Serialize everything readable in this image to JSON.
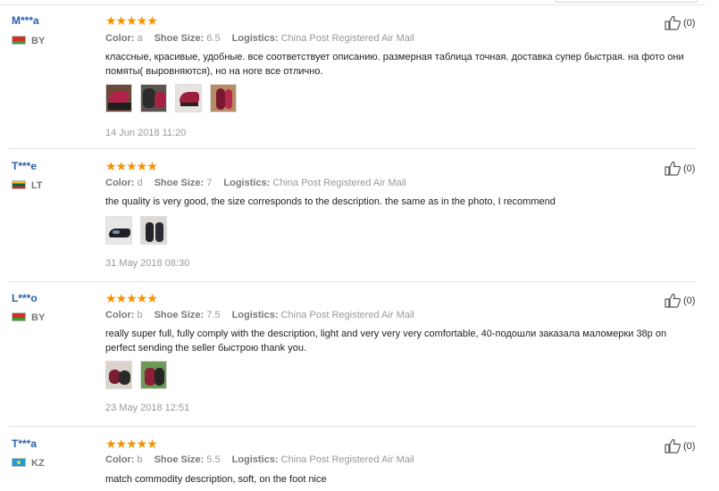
{
  "reviews": [
    {
      "user": "M***a",
      "country": "BY",
      "flag": "by",
      "rating": "★★★★★",
      "color_label": "Color:",
      "color_value": "a",
      "size_label": "Shoe Size:",
      "size_value": "6.5",
      "logistics_label": "Logistics:",
      "logistics_value": "China Post Registered Air Mail",
      "text": "классные, красивые, удобные. все соответствует описанию. размерная таблица точная. доставка супер быстрая. на фото они помяты( выровняются), но на ноге все отлично.",
      "photo_count": 4,
      "date": "14 Jun 2018 11:20",
      "helpful": "(0)"
    },
    {
      "user": "T***e",
      "country": "LT",
      "flag": "lt",
      "rating": "★★★★★",
      "color_label": "Color:",
      "color_value": "d",
      "size_label": "Shoe Size:",
      "size_value": "7",
      "logistics_label": "Logistics:",
      "logistics_value": "China Post Registered Air Mail",
      "text": "the quality is very good, the size corresponds to the description. the same as in the photo, I recommend",
      "photo_count": 2,
      "date": "31 May 2018 08:30",
      "helpful": "(0)"
    },
    {
      "user": "L***o",
      "country": "BY",
      "flag": "by",
      "rating": "★★★★★",
      "color_label": "Color:",
      "color_value": "b",
      "size_label": "Shoe Size:",
      "size_value": "7.5",
      "logistics_label": "Logistics:",
      "logistics_value": "China Post Registered Air Mail",
      "text": "really super full, fully comply with the description, light and very very very comfortable, 40-подошли заказала маломерки 38р on perfect sending the seller быстрою thank you.",
      "photo_count": 2,
      "date": "23 May 2018 12:51",
      "helpful": "(0)"
    },
    {
      "user": "T***a",
      "country": "KZ",
      "flag": "kz",
      "rating": "★★★★★",
      "color_label": "Color:",
      "color_value": "b",
      "size_label": "Shoe Size:",
      "size_value": "5.5",
      "logistics_label": "Logistics:",
      "logistics_value": "China Post Registered Air Mail",
      "text": "match commodity description, soft, on the foot nice",
      "helpful": "(0)"
    }
  ]
}
